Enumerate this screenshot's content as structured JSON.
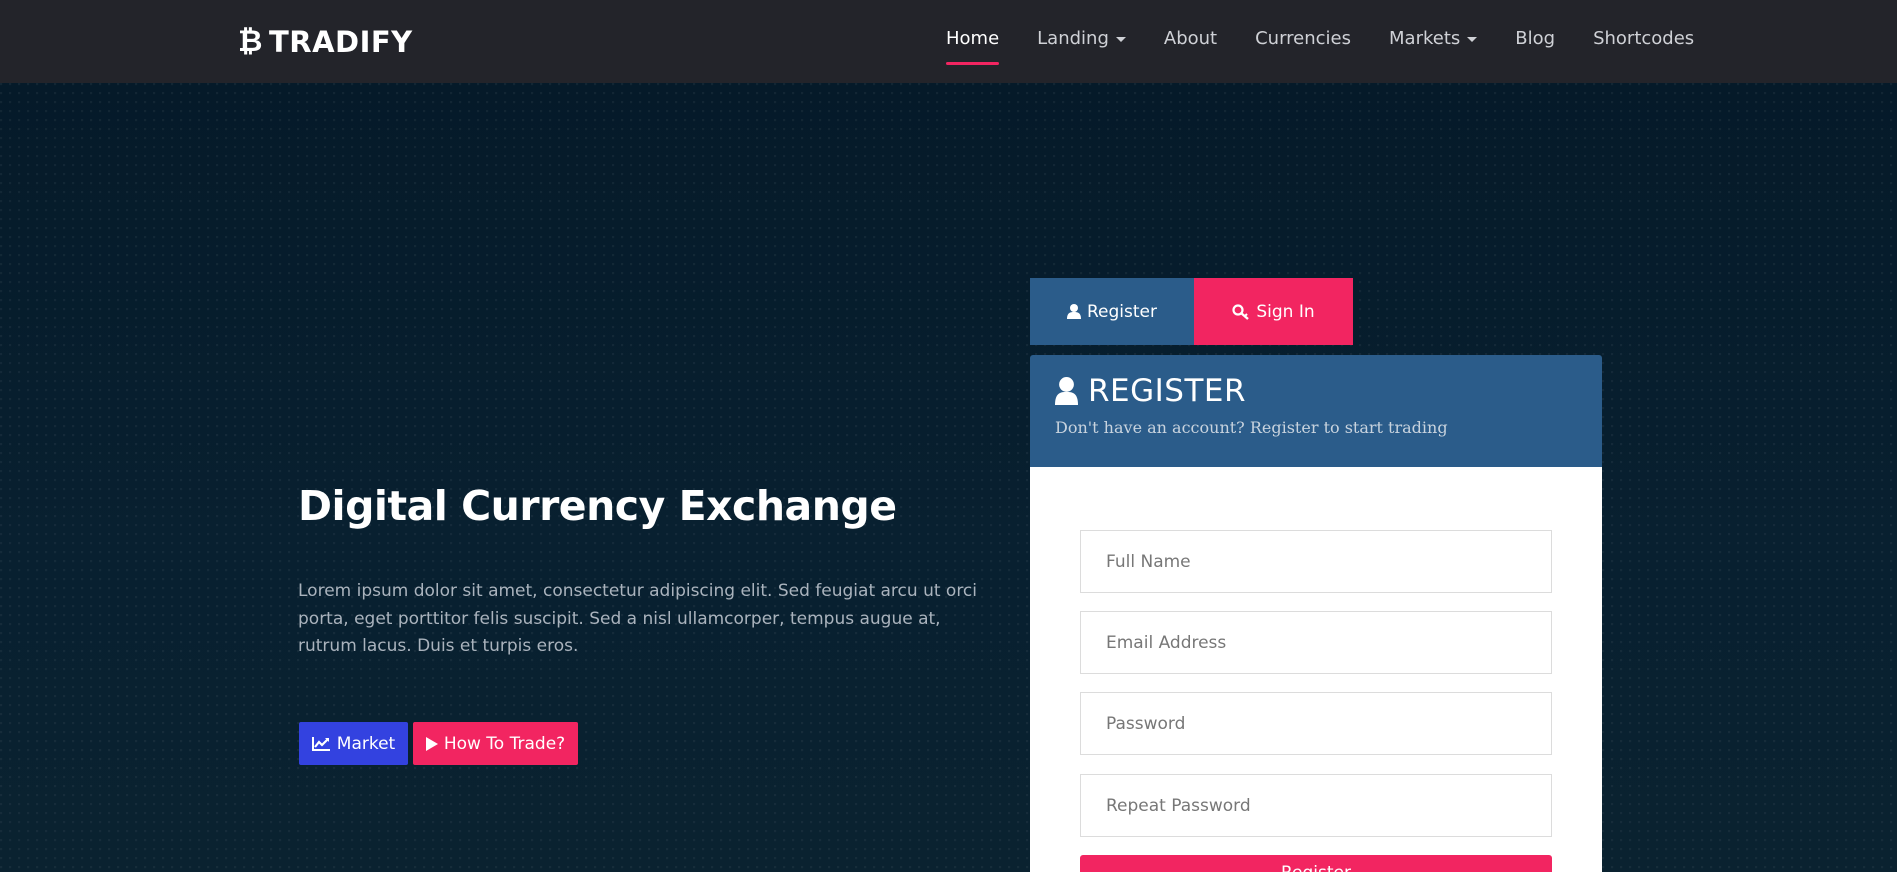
{
  "brand": {
    "icon": "bitcoin-icon",
    "name": "TRADIFY"
  },
  "nav": {
    "items": [
      {
        "label": "Home",
        "active": true
      },
      {
        "label": "Landing",
        "dropdown": true
      },
      {
        "label": "About"
      },
      {
        "label": "Currencies"
      },
      {
        "label": "Markets",
        "dropdown": true
      },
      {
        "label": "Blog"
      },
      {
        "label": "Shortcodes"
      }
    ]
  },
  "hero": {
    "title": "Digital Currency Exchange",
    "text": "Lorem ipsum dolor sit amet, consectetur adipiscing elit. Sed feugiat arcu ut orci porta, eget porttitor felis suscipit. Sed a nisl ullamcorper, tempus augue at, rutrum lacus. Duis et turpis eros.",
    "buttons": {
      "market_label": "Market",
      "trade_label": "How To Trade?"
    }
  },
  "auth": {
    "tabs": {
      "register_label": "Register",
      "signin_label": "Sign In"
    },
    "panel": {
      "title": "REGISTER",
      "subtitle": "Don't have an account? Register to start trading"
    },
    "fields": {
      "full_name": "Full Name",
      "email": "Email Address",
      "password": "Password",
      "repeat_password": "Repeat Password"
    },
    "submit_label": "Register"
  },
  "colors": {
    "accent": "#f22561",
    "panel": "#2b5c8a",
    "market_button": "#3342e0",
    "navbar": "#23242a"
  }
}
